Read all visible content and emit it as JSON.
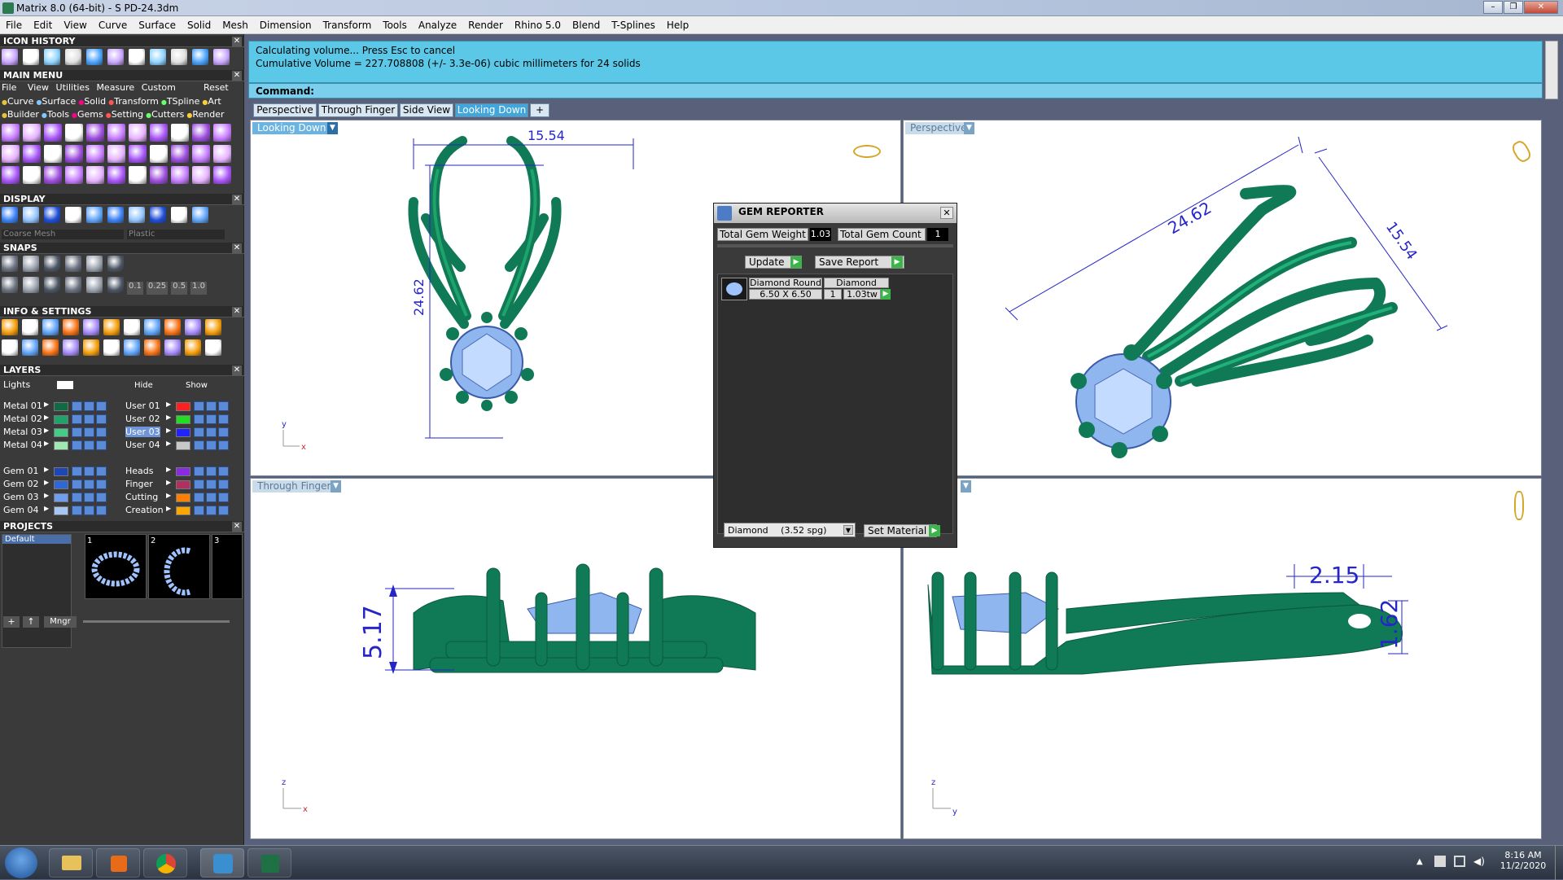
{
  "window": {
    "title": "Matrix 8.0 (64-bit) - S PD-24.3dm"
  },
  "menubar": [
    "File",
    "Edit",
    "View",
    "Curve",
    "Surface",
    "Solid",
    "Mesh",
    "Dimension",
    "Transform",
    "Tools",
    "Analyze",
    "Render",
    "Rhino 5.0",
    "Blend",
    "T-Splines",
    "Help"
  ],
  "left": {
    "icon_history": "ICON HISTORY",
    "main_menu": "MAIN MENU",
    "main_menu_items": [
      "File",
      "View",
      "Utilities",
      "Measure",
      "Custom"
    ],
    "reset": "Reset",
    "categories_row1": [
      "Curve",
      "Surface",
      "Solid",
      "Transform",
      "TSpline",
      "Art"
    ],
    "categories_row2": [
      "Builder",
      "Tools",
      "Gems",
      "Setting",
      "Cutters",
      "Render"
    ],
    "display": "DISPLAY",
    "display_mesh": "Coarse Mesh",
    "display_material": "Plastic",
    "snaps": "SNAPS",
    "snap_values": [
      "0.1",
      "0.25",
      "0.5",
      "1.0"
    ],
    "info_settings": "INFO & SETTINGS",
    "layers": "LAYERS",
    "lights": "Lights",
    "hide": "Hide",
    "show": "Show",
    "layers_left": [
      "Metal 01",
      "Metal 02",
      "Metal 03",
      "Metal 04",
      "Gem 01",
      "Gem 02",
      "Gem 03",
      "Gem 04"
    ],
    "layers_right": [
      "User 01",
      "User 02",
      "User 03",
      "User 04",
      "Heads",
      "Finger",
      "Cutting",
      "Creation"
    ],
    "colors_left": [
      "#0e6b46",
      "#1fa36a",
      "#45cc86",
      "#9fe8b2",
      "#1e46b4",
      "#2f68d6",
      "#6e9ef0",
      "#a8c6f4"
    ],
    "colors_right": [
      "#ff2020",
      "#22dd22",
      "#2222ff",
      "#c8c8c8",
      "#8a2be2",
      "#b03060",
      "#ff7f00",
      "#ffa500"
    ],
    "projects": "PROJECTS",
    "project_default": "Default",
    "project_slots": [
      "1",
      "2",
      "3"
    ],
    "mngr": "Mngr"
  },
  "command": {
    "line1": "Calculating volume... Press Esc to cancel",
    "line2": "Cumulative Volume = 227.708808 (+/- 3.3e-06) cubic millimeters for 24 solids",
    "prompt": "Command:"
  },
  "tabs": [
    "Perspective",
    "Through Finger",
    "Side View",
    "Looking Down"
  ],
  "active_tab": "Looking Down",
  "add_tab": "+",
  "viewports": {
    "top_left": {
      "label": "Looking Down",
      "dim_width": "15.54",
      "dim_height": "24.62",
      "axis_v": "y",
      "axis_h": "x"
    },
    "top_right": {
      "label": "Perspective",
      "dim_length": "24.62",
      "dim_width": "15.54"
    },
    "bottom_left": {
      "label": "Through Finger",
      "dim_height": "5.17",
      "axis_v": "z",
      "axis_h": "x"
    },
    "bottom_right": {
      "dim_top": "2.15",
      "dim_side": "1.62",
      "axis_v": "z",
      "axis_h": "y"
    }
  },
  "gem_reporter": {
    "title": "GEM REPORTER",
    "total_weight_label": "Total Gem Weight",
    "total_weight": "1.03",
    "total_count_label": "Total Gem Count",
    "total_count": "1",
    "update": "Update",
    "save_report": "Save Report",
    "row_name": "Diamond Round",
    "row_type": "Diamond",
    "row_size": "6.50 X 6.50",
    "row_qty": "1",
    "row_weight": "1.03tw",
    "material": "Diamond",
    "material_spg": "(3.52 spg)",
    "set_material": "Set Material"
  },
  "taskbar": {
    "time": "8:16 AM",
    "date": "11/2/2020"
  }
}
